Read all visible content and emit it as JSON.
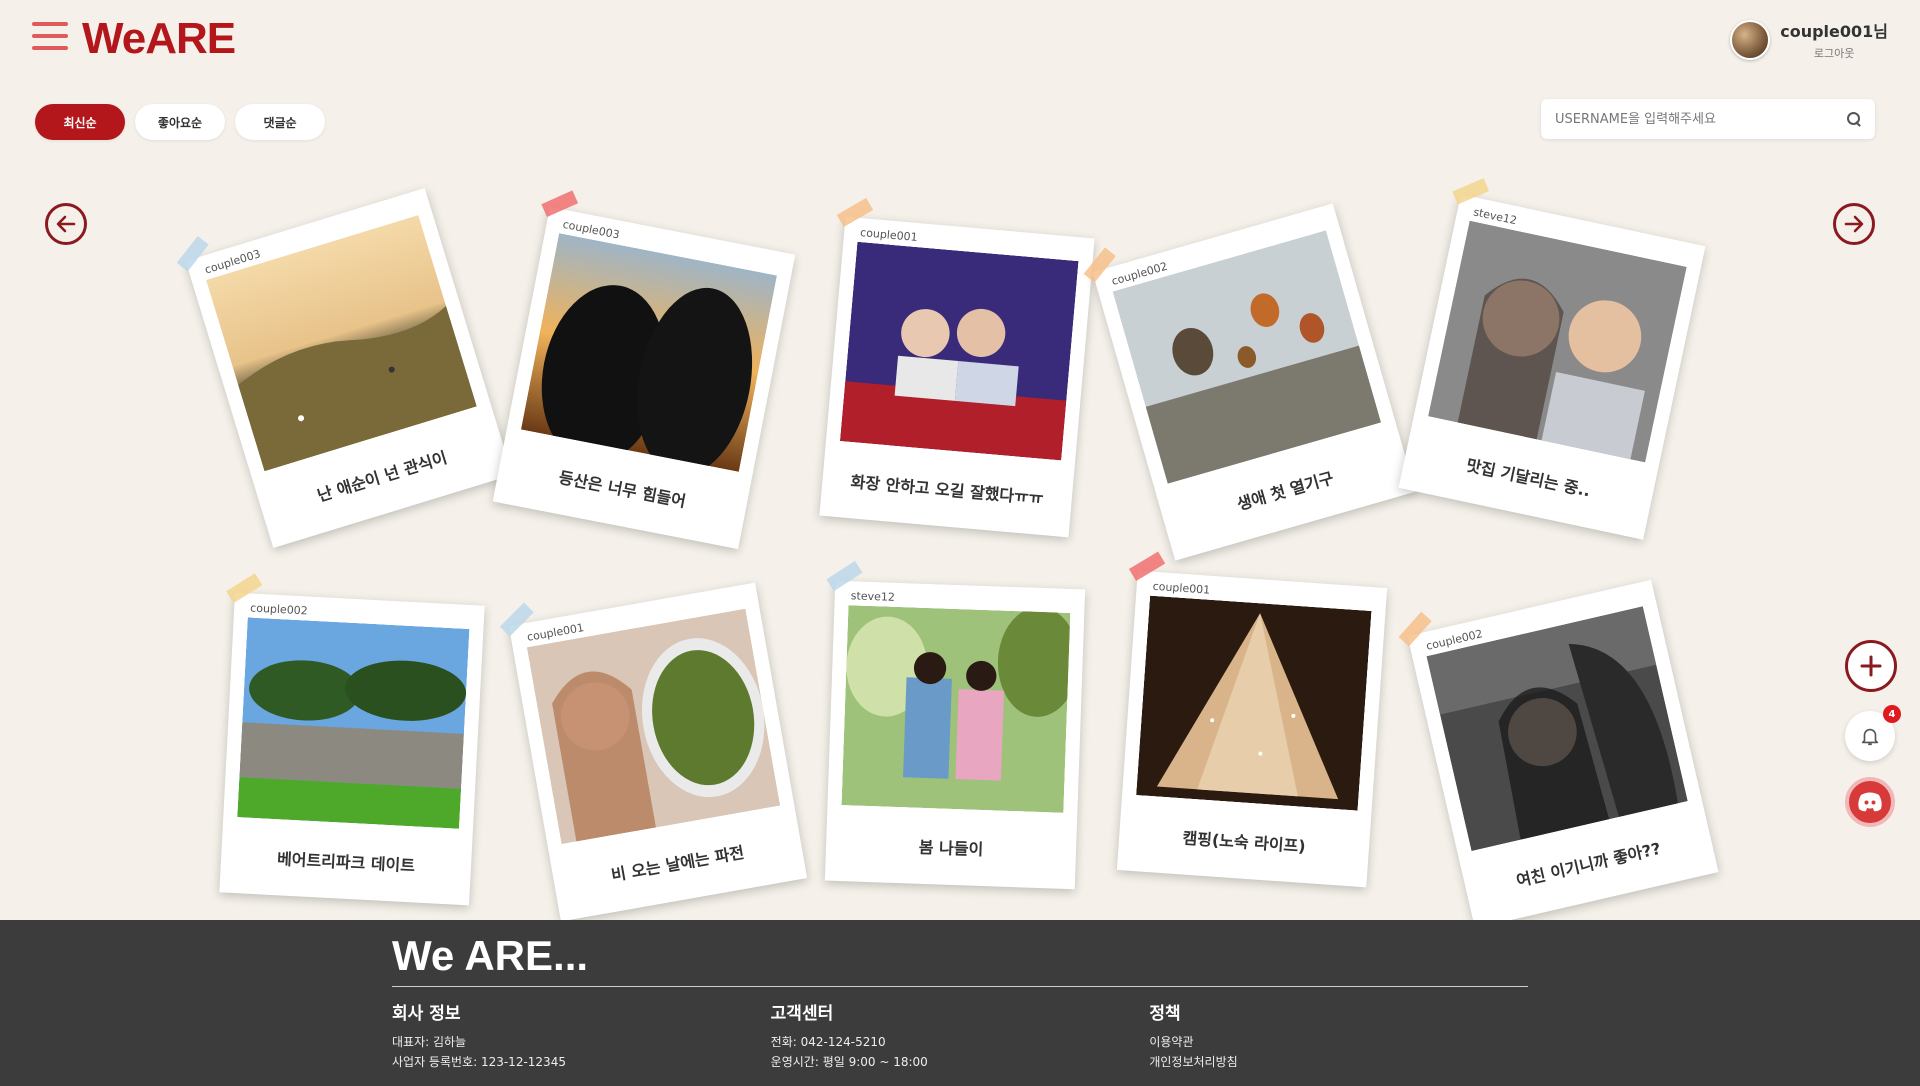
{
  "header": {
    "logo": "WeARE",
    "user_name": "couple001님",
    "logout_label": "로그아웃"
  },
  "sort": {
    "buttons": [
      "최신순",
      "좋아요순",
      "댓글순"
    ],
    "active_index": 0
  },
  "search": {
    "placeholder": "USERNAME을 입력해주세요",
    "value": ""
  },
  "posts": [
    {
      "author": "couple003",
      "caption": "난 애순이 넌 관식이",
      "tape_color": "#bcd7ea"
    },
    {
      "author": "couple003",
      "caption": "등산은 너무 힘들어",
      "tape_color": "#f07070"
    },
    {
      "author": "couple001",
      "caption": "화장 안하고 오길 잘했다ㅠㅠ",
      "tape_color": "#f6c08a"
    },
    {
      "author": "couple002",
      "caption": "생애 첫 열기구",
      "tape_color": "#f6c08a"
    },
    {
      "author": "steve12",
      "caption": "맛집 기달리는 중..",
      "tape_color": "#f3d58e"
    },
    {
      "author": "couple002",
      "caption": "베어트리파크 데이트",
      "tape_color": "#f3d58e"
    },
    {
      "author": "couple001",
      "caption": "비 오는 날에는 파전",
      "tape_color": "#bcd7ea"
    },
    {
      "author": "steve12",
      "caption": "봄 나들이",
      "tape_color": "#bcd7ea"
    },
    {
      "author": "couple001",
      "caption": "캠핑(노숙 라이프)",
      "tape_color": "#f07070"
    },
    {
      "author": "couple002",
      "caption": "여친 이기니까 좋아??",
      "tape_color": "#f6c08a"
    }
  ],
  "notifications": {
    "count": "4"
  },
  "icons": {
    "menu": "hamburger-menu-icon",
    "prev": "arrow-left-circle-icon",
    "next": "arrow-right-circle-icon",
    "add": "plus-icon",
    "bell": "bell-icon",
    "discord": "discord-icon",
    "search": "search-icon"
  },
  "colors": {
    "brand": "#b3161b",
    "accent": "#8a1a1f",
    "background": "#f5f1ea",
    "footer": "#3c3c3c"
  },
  "footer": {
    "brand": "We ARE...",
    "company": {
      "title": "회사 정보",
      "lines": [
        "대표자: 김하늘",
        "사업자 등록번호: 123-12-12345"
      ]
    },
    "support": {
      "title": "고객센터",
      "lines": [
        "전화: 042-124-5210",
        "운영시간: 평일 9:00 ~ 18:00"
      ]
    },
    "policy": {
      "title": "정책",
      "lines": [
        "이용약관",
        "개인정보처리방침"
      ]
    }
  }
}
